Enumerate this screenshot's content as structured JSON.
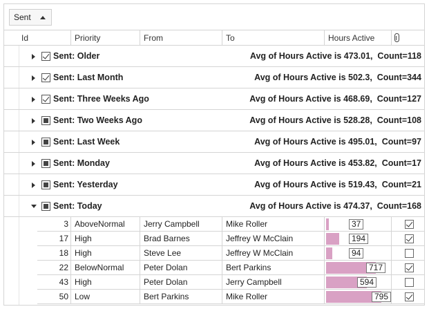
{
  "group_panel": {
    "chip_label": "Sent"
  },
  "columns": {
    "id": "Id",
    "priority": "Priority",
    "from": "From",
    "to": "To",
    "hours": "Hours Active",
    "attachment_icon": "paperclip-icon"
  },
  "groups": [
    {
      "label": "Sent: Older",
      "check": "checked",
      "summary": "Avg of Hours Active is 473.01,  Count=118",
      "expanded": false
    },
    {
      "label": "Sent: Last Month",
      "check": "checked",
      "summary": "Avg of Hours Active is 502.3,  Count=344",
      "expanded": false
    },
    {
      "label": "Sent: Three Weeks Ago",
      "check": "checked",
      "summary": "Avg of Hours Active is 468.69,  Count=127",
      "expanded": false
    },
    {
      "label": "Sent: Two Weeks Ago",
      "check": "filled",
      "summary": "Avg of Hours Active is 528.28,  Count=108",
      "expanded": false
    },
    {
      "label": "Sent: Last Week",
      "check": "filled",
      "summary": "Avg of Hours Active is 495.01,  Count=97",
      "expanded": false
    },
    {
      "label": "Sent: Monday",
      "check": "filled",
      "summary": "Avg of Hours Active is 453.82,  Count=17",
      "expanded": false
    },
    {
      "label": "Sent: Yesterday",
      "check": "filled",
      "summary": "Avg of Hours Active is 519.43,  Count=21",
      "expanded": false
    },
    {
      "label": "Sent: Today",
      "check": "filled",
      "summary": "Avg of Hours Active is 474.37,  Count=168",
      "expanded": true
    }
  ],
  "rows": [
    {
      "id": "3",
      "priority": "AboveNormal",
      "from": "Jerry Campbell",
      "to": "Mike Roller",
      "hours": 37,
      "hours_label": "37",
      "attachment": true
    },
    {
      "id": "17",
      "priority": "High",
      "from": "Brad Barnes",
      "to": "Jeffrey W McClain",
      "hours": 194,
      "hours_label": "194",
      "attachment": true
    },
    {
      "id": "18",
      "priority": "High",
      "from": "Steve Lee",
      "to": "Jeffrey W McClain",
      "hours": 94,
      "hours_label": "94",
      "attachment": false
    },
    {
      "id": "22",
      "priority": "BelowNormal",
      "from": "Peter Dolan",
      "to": "Bert Parkins",
      "hours": 717,
      "hours_label": "717",
      "attachment": true
    },
    {
      "id": "43",
      "priority": "High",
      "from": "Peter Dolan",
      "to": "Jerry Campbell",
      "hours": 594,
      "hours_label": "594",
      "attachment": false
    },
    {
      "id": "50",
      "priority": "Low",
      "from": "Bert Parkins",
      "to": "Mike Roller",
      "hours": 795,
      "hours_label": "795",
      "attachment": true
    }
  ],
  "hours_max": 900,
  "colors": {
    "bar": "#d9a1c4",
    "border": "#d4d4d4"
  }
}
